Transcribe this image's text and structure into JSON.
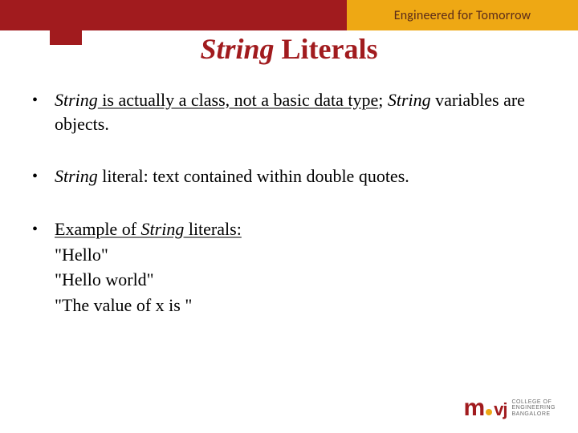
{
  "header": {
    "tagline": "Engineered for Tomorrow"
  },
  "title": {
    "italic_part": "String",
    "rest": " Literals"
  },
  "bullets": {
    "b1": {
      "seg1_em": "String",
      "seg2": " is actually a class, not a basic data type",
      "seg3": "; ",
      "seg4_em": "String",
      "seg5": " variables are objects."
    },
    "b2": {
      "seg1_em": "String",
      "seg2": " literal: text contained within double quotes."
    },
    "b3": {
      "lead_pre": "Example of ",
      "lead_em": "String",
      "lead_post": " literals:",
      "lines": {
        "l1": "\"Hello\"",
        "l2": "\"Hello world\"",
        "l3": "\"The value of x is \""
      }
    }
  },
  "logo": {
    "m": "m",
    "vj": "vj",
    "line1": "COLLEGE OF",
    "line2": "ENGINEERING",
    "line3": "BANGALORE"
  }
}
